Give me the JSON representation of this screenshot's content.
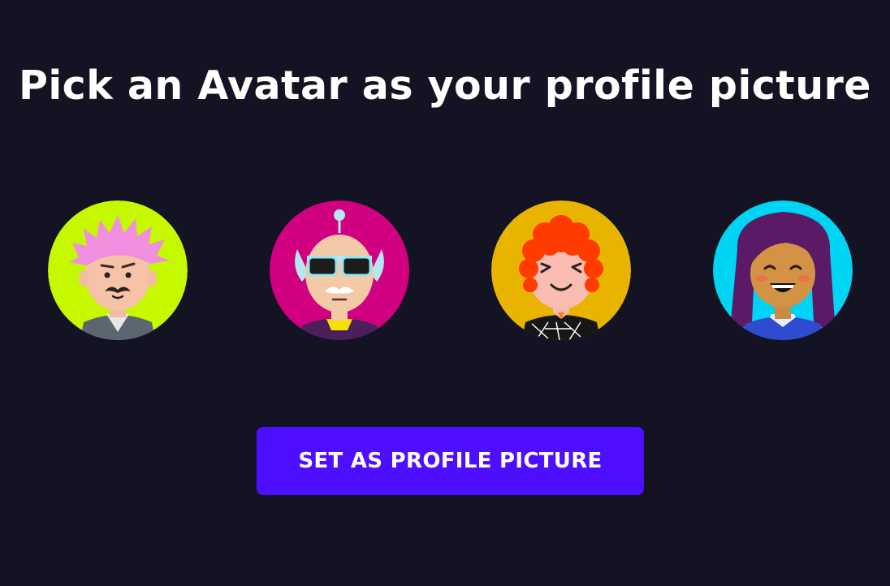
{
  "heading": "Pick an Avatar as your profile picture",
  "avatars": [
    {
      "id": "avatar-1",
      "background": "#c6f800",
      "hair": "#f08ee0"
    },
    {
      "id": "avatar-2",
      "background": "#d10080",
      "hair": "#b6e6f0"
    },
    {
      "id": "avatar-3",
      "background": "#e8b400",
      "hair": "#ff3b00"
    },
    {
      "id": "avatar-4",
      "background": "#00d4f5",
      "hair": "#5a1a66"
    }
  ],
  "button": {
    "label": "SET AS PROFILE PICTURE",
    "color": "#4e0eff"
  },
  "colors": {
    "background": "#131324",
    "text": "#ffffff"
  }
}
